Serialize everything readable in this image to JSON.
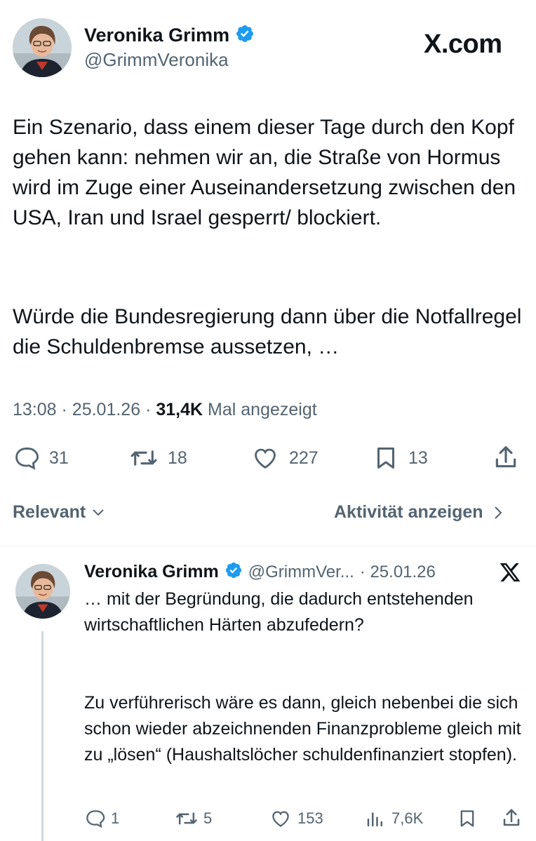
{
  "main_tweet": {
    "author_name": "Veronika Grimm",
    "handle": "@GrimmVeronika",
    "brand": "X.com",
    "text_p1": "Ein Szenario, dass einem dieser Tage durch den Kopf gehen kann: nehmen wir an, die Straße von Hormus wird im Zuge einer Auseinandersetzung zwischen den USA, Iran und Israel gesperrt/ blockiert.",
    "text_p2": "Würde die Bundesregierung dann über die Notfallregel die Schuldenbremse aussetzen, …",
    "time": "13:08",
    "date": "25.01.26",
    "views": "31,4K",
    "views_label": "Mal angezeigt",
    "replies": "31",
    "reposts": "18",
    "likes": "227",
    "bookmarks": "13"
  },
  "sort": {
    "label": "Relevant",
    "activity_label": "Aktivität anzeigen"
  },
  "reply_tweet": {
    "author_name": "Veronika Grimm",
    "handle": "@GrimmVer...",
    "date": "· 25.01.26",
    "text_p1": "… mit der Begründung, die dadurch entstehenden wirtschaftlichen Härten abzufedern?",
    "text_p2": "Zu verführerisch wäre es dann, gleich nebenbei die sich schon wieder abzeichnenden Finanzprobleme gleich mit zu „lösen“ (Haushaltslöcher schuldenfinanziert stopfen).",
    "replies": "1",
    "reposts": "5",
    "likes": "153",
    "views": "7,6K"
  },
  "colors": {
    "verified": "#1d9bf0",
    "text": "#0f1419",
    "muted": "#536471"
  }
}
